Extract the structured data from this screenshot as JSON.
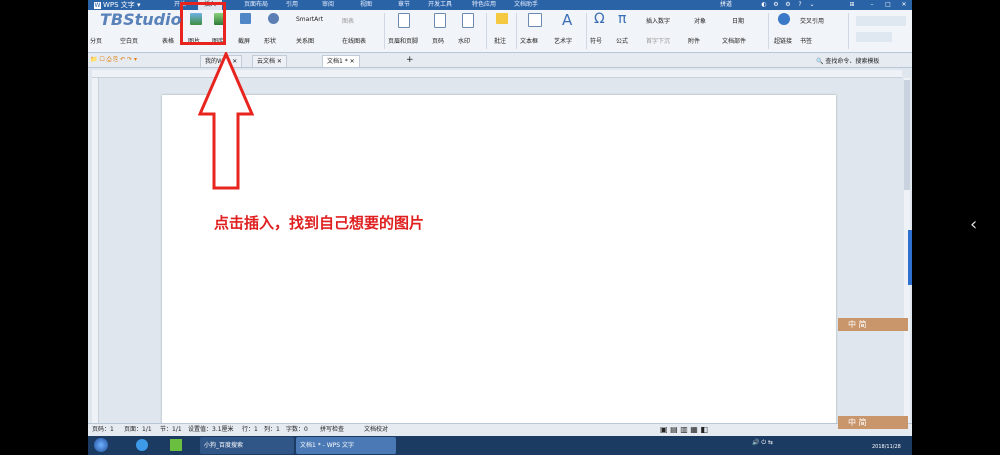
{
  "app": {
    "title": "WPS 文字"
  },
  "menu_tabs": [
    "开始",
    "插入",
    "页面布局",
    "引用",
    "审阅",
    "视图",
    "章节",
    "开发工具",
    "特色应用",
    "文档助手"
  ],
  "menu_active": "插入",
  "user": {
    "name": "拼道"
  },
  "watermark": "TBStudio",
  "ribbon": {
    "page_label": "分页",
    "blank_page_label": "空白页",
    "table_label": "表格",
    "picture_label": "图片",
    "gallery_label": "图库",
    "screenshot_label": "截屏",
    "shapes_label": "形状",
    "smartart_label": "SmartArt",
    "chart_label": "图表",
    "relation_label": "关系图",
    "online_chart_label": "在线图表",
    "header_footer_label": "页眉和页脚",
    "page_number_label": "页码",
    "watermark_label": "水印",
    "comment_label": "批注",
    "textbox_label": "文本框",
    "wordart_label": "艺术字",
    "symbol_label": "符号",
    "formula_label": "公式",
    "insert_number_label": "插入数字",
    "object_label": "对象",
    "date_label": "日期",
    "first_drop_label": "首字下沉",
    "attachment_label": "附件",
    "doc_parts_label": "文档部件",
    "hyperlink_label": "超链接",
    "crossref_label": "交叉引用",
    "bookmark_label": "书签"
  },
  "doc_tabs": [
    "我的WPS",
    "云文档",
    "文档1 *"
  ],
  "search": {
    "placeholder": "查找命令、搜索模板"
  },
  "instruction": "点击插入，找到自己想要的图片",
  "status": {
    "page": "页码：1",
    "pages": "页面：1/1",
    "section": "节：1/1",
    "setting": "设置值：3.1厘米",
    "row": "行：1",
    "col": "列：1",
    "words": "字数：0",
    "spell": "拼写检查",
    "doc_check": "文档校对"
  },
  "taskbar": {
    "items": [
      "小狗_百度搜索",
      "文档1 * - WPS 文字"
    ],
    "clock": "2018/11/28"
  },
  "side_badge": "中 简",
  "colors": {
    "accent": "#2b63a7",
    "highlight": "#e8241f",
    "instruction": "#e02020"
  }
}
